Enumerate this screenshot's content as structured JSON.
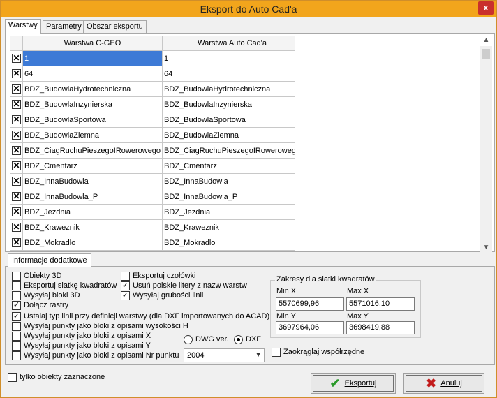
{
  "window": {
    "title": "Eksport do Auto Cad'a",
    "close_label": "x"
  },
  "tabs": [
    {
      "label": "Warstwy",
      "active": true
    },
    {
      "label": "Parametry",
      "active": false
    },
    {
      "label": "Obszar eksportu",
      "active": false
    }
  ],
  "grid": {
    "headers": [
      "Warstwa C-GEO",
      "Warstwa Auto Cad'a"
    ],
    "rows": [
      {
        "checked": true,
        "cgeo": "1",
        "acad": "1",
        "selected": true
      },
      {
        "checked": true,
        "cgeo": "64",
        "acad": "64"
      },
      {
        "checked": true,
        "cgeo": "BDZ_BudowlaHydrotechniczna",
        "acad": "BDZ_BudowlaHydrotechniczna"
      },
      {
        "checked": true,
        "cgeo": "BDZ_BudowlaInzynierska",
        "acad": "BDZ_BudowlaInzynierska"
      },
      {
        "checked": true,
        "cgeo": "BDZ_BudowlaSportowa",
        "acad": "BDZ_BudowlaSportowa"
      },
      {
        "checked": true,
        "cgeo": "BDZ_BudowlaZiemna",
        "acad": "BDZ_BudowlaZiemna"
      },
      {
        "checked": true,
        "cgeo": "BDZ_CiagRuchuPieszegoIRowerowego",
        "acad": "BDZ_CiagRuchuPieszegoIRowerowego"
      },
      {
        "checked": true,
        "cgeo": "BDZ_Cmentarz",
        "acad": "BDZ_Cmentarz"
      },
      {
        "checked": true,
        "cgeo": "BDZ_InnaBudowla",
        "acad": "BDZ_InnaBudowla"
      },
      {
        "checked": true,
        "cgeo": "BDZ_InnaBudowla_P",
        "acad": "BDZ_InnaBudowla_P"
      },
      {
        "checked": true,
        "cgeo": "BDZ_Jezdnia",
        "acad": "BDZ_Jezdnia"
      },
      {
        "checked": true,
        "cgeo": "BDZ_Kraweznik",
        "acad": "BDZ_Kraweznik"
      },
      {
        "checked": true,
        "cgeo": "BDZ_Mokradlo",
        "acad": "BDZ_Mokradlo"
      },
      {
        "checked": true,
        "cgeo": "",
        "acad": ""
      }
    ]
  },
  "extra": {
    "tab_label": "Informacje dodatkowe",
    "options": {
      "obiekty3d": {
        "label": "Obiekty  3D",
        "checked": false
      },
      "eksportuj_siatke": {
        "label": "Eksportuj siatkę kwadratów",
        "checked": false
      },
      "wysylaj_bloki_3d": {
        "label": "Wysyłaj bloki 3D",
        "checked": false
      },
      "dolacz_rastry": {
        "label": "Dołącz rastry",
        "checked": true
      },
      "eksportuj_czolowki": {
        "label": "Eksportuj czołówki",
        "checked": false
      },
      "usun_polskie": {
        "label": "Usuń polskie litery z nazw warstw",
        "checked": true
      },
      "wysylaj_grubosci": {
        "label": "Wysyłaj grubości linii",
        "checked": true
      },
      "ustalaj_typ": {
        "label": "Ustalaj typ linii przy definicji warstwy (dla DXF importowanych do ACAD)",
        "checked": true
      },
      "punkty_h": {
        "label": "Wysyłaj punkty jako bloki z opisami wysokości H",
        "checked": false
      },
      "punkty_x": {
        "label": "Wysyłaj punkty jako bloki z opisami X",
        "checked": false
      },
      "punkty_y": {
        "label": "Wysyłaj punkty jako bloki z opisami Y",
        "checked": false
      },
      "punkty_nr": {
        "label": "Wysyłaj punkty jako bloki z opisami Nr punktu",
        "checked": false
      }
    },
    "format": {
      "dwg_label": "DWG ver.",
      "dxf_label": "DXF",
      "selected": "DXF"
    },
    "version_select": "2004",
    "grid_ranges": {
      "legend": "Zakresy dla siatki kwadratów",
      "min_x_label": "Min X",
      "max_x_label": "Max X",
      "min_y_label": "Min Y",
      "max_y_label": "Max Y",
      "min_x": "5570699,96",
      "max_x": "5571016,10",
      "min_y": "3697964,06",
      "max_y": "3698419,88"
    },
    "zaokraglaj": {
      "label": "Zaokrąglaj współrzędne",
      "checked": false
    }
  },
  "footer": {
    "tylko_zaznaczone": {
      "label": "tylko obiekty zaznaczone",
      "checked": false
    },
    "export_label": "Eksportuj",
    "cancel_label": "Anuluj"
  }
}
